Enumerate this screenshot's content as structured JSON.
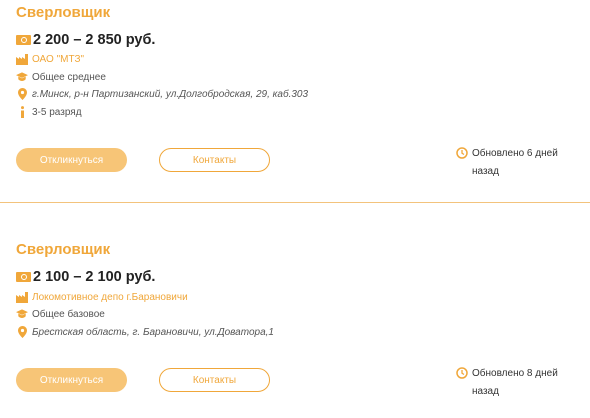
{
  "vacancies": [
    {
      "title": "Сверловщик",
      "salary": "2 200 – 2 850 руб.",
      "company": "ОАО \"МТЗ\"",
      "education": "Общее среднее",
      "address": "г.Минск, р-н Партизанский, ул.Долгобродская, 29, каб.303",
      "grade": "3-5 разряд",
      "apply_label": "Откликнуться",
      "contacts_label": "Контакты",
      "updated_line1": "Обновлено 6 дней",
      "updated_line2": "назад"
    },
    {
      "title": "Сверловщик",
      "salary": "2 100 – 2 100 руб.",
      "company": "Локомотивное депо г.Барановичи",
      "education": "Общее базовое",
      "address": "Брестская область, г. Барановичи, ул.Доватора,1",
      "apply_label": "Откликнуться",
      "contacts_label": "Контакты",
      "updated_line1": "Обновлено 8 дней",
      "updated_line2": "назад"
    }
  ],
  "colors": {
    "accent": "#f0a73a",
    "button_fill": "#f7c577",
    "separator": "#f3c37c"
  },
  "icons": {
    "salary": "money-icon",
    "company": "factory-icon",
    "education": "graduation-cap-icon",
    "address": "map-pin-icon",
    "grade": "info-icon",
    "updated": "clock-icon"
  }
}
